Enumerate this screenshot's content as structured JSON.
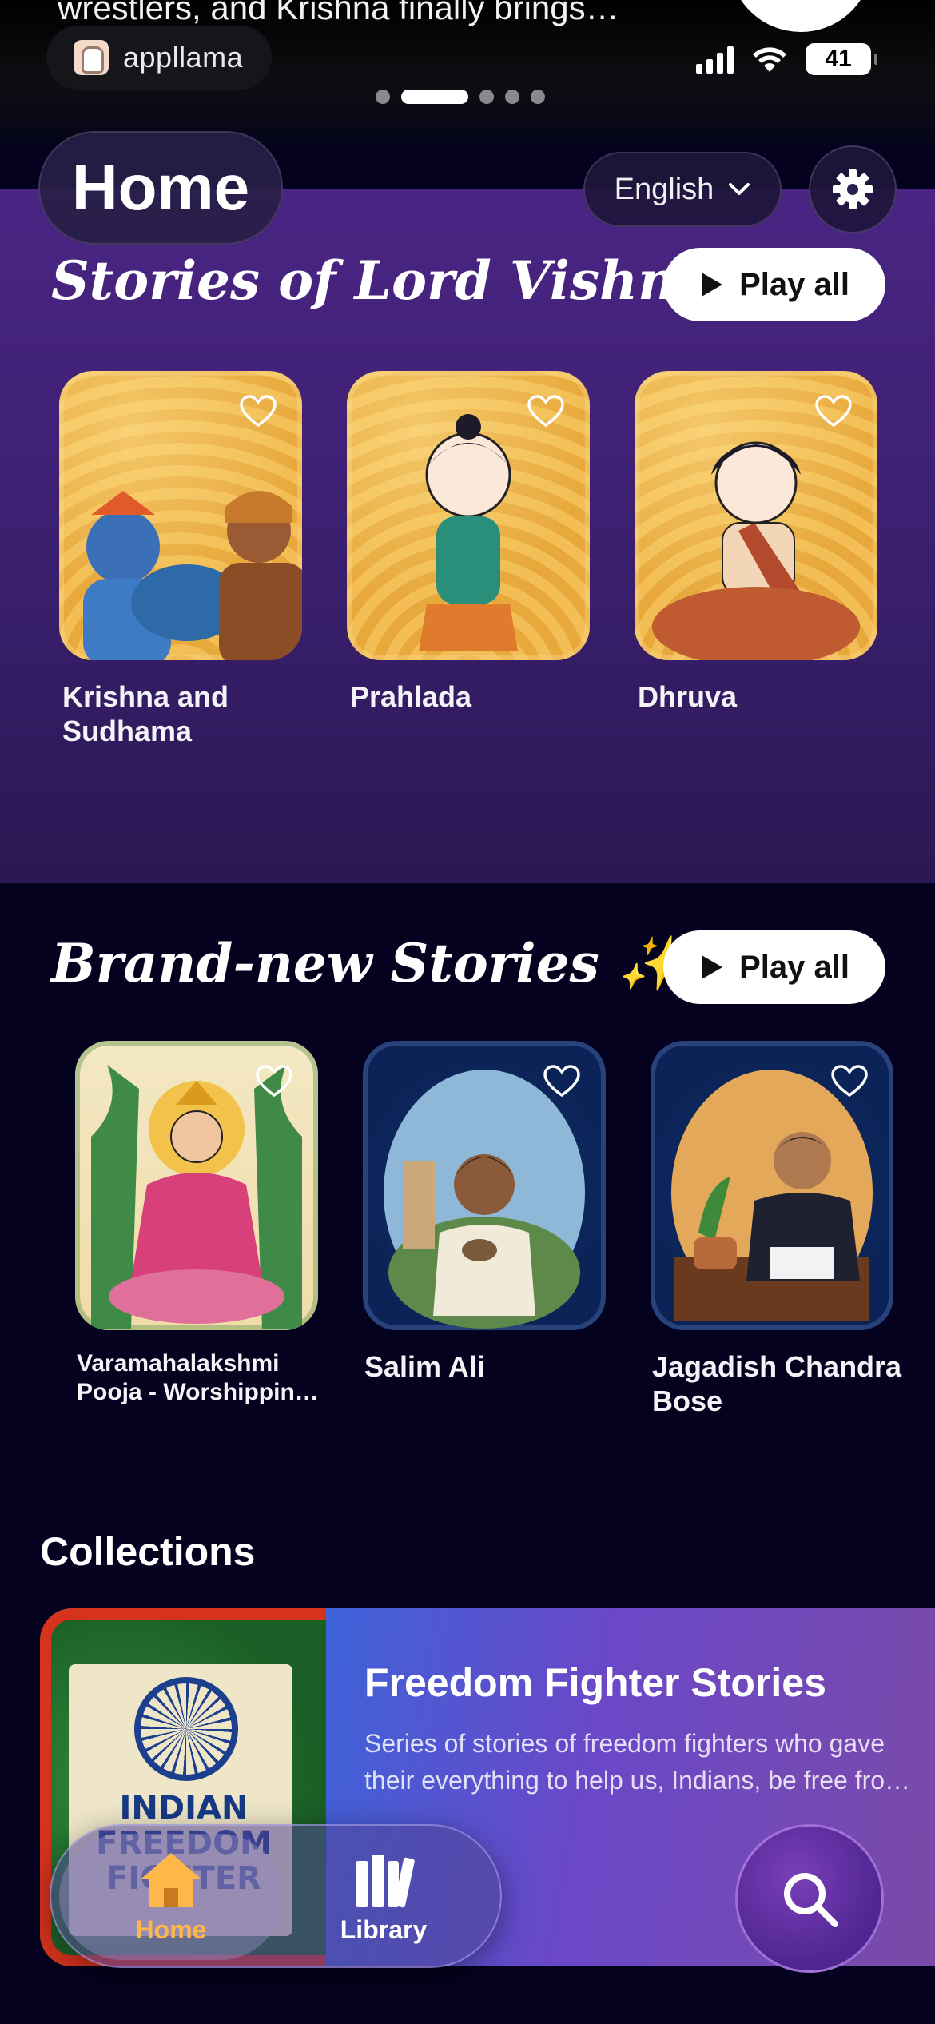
{
  "now_playing": {
    "title": "wrestlers, and Krishna finally brings…"
  },
  "status_bar": {
    "app_name": "appllama",
    "battery": "41"
  },
  "header": {
    "title": "Home",
    "language": "English"
  },
  "sections": [
    {
      "title": "Stories of Lord Vishnu",
      "play_all": "Play all",
      "cards": [
        {
          "label": "Krishna and Sudhama"
        },
        {
          "label": "Prahlada"
        },
        {
          "label": "Dhruva"
        }
      ]
    },
    {
      "title": "Brand-new Stories ✨",
      "play_all": "Play all",
      "cards": [
        {
          "label": "Varamahalakshmi Pooja - Worshippin…"
        },
        {
          "label": "Salim Ali"
        },
        {
          "label": "Jagadish Chandra Bose"
        }
      ]
    }
  ],
  "collections": {
    "title": "Collections",
    "items": [
      {
        "name": "Freedom Fighter Stories",
        "description": "Series of stories of freedom fighters who gave their everything to help us, Indians, be free fro…",
        "art_text": "INDIAN FREEDOM FIGHTER"
      }
    ]
  },
  "bottom_nav": {
    "home": "Home",
    "library": "Library"
  },
  "colors": {
    "accent": "#ffb74a",
    "section_purple": "#3a1f6e",
    "background": "#04021e"
  }
}
